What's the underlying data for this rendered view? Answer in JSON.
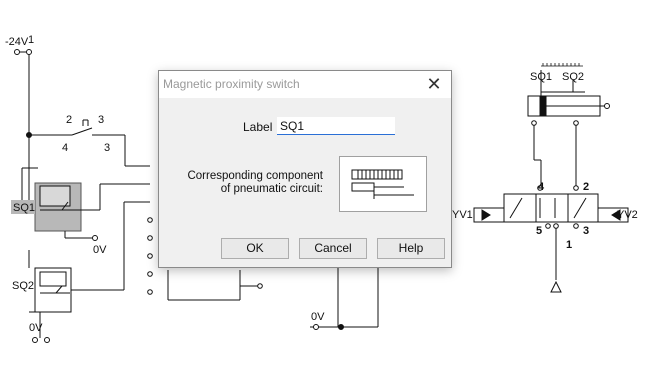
{
  "dialog": {
    "title": "Magnetic proximity switch",
    "close_glyph": "✕",
    "label_caption": "Label",
    "label_value": "SQ1",
    "component_caption": "Corresponding component of pneumatic circuit:",
    "buttons": {
      "ok": "OK",
      "cancel": "Cancel",
      "help": "Help"
    }
  },
  "electrical": {
    "supply_label": "-24V",
    "supply_node": "1",
    "switch_numbers": [
      "2",
      "3",
      "4",
      "3"
    ],
    "sensor_labels": [
      "SQ1",
      "SQ2"
    ],
    "ground_labels": [
      "0V",
      "0V",
      "0V"
    ]
  },
  "pneumatic": {
    "cylinder_sensor_labels": [
      "SQ1",
      "SQ2"
    ],
    "valve_left_label": "YV1",
    "valve_right_label": "YV2",
    "port_numbers": [
      "4",
      "2",
      "5",
      "3",
      "1"
    ]
  },
  "colors": {
    "selection": "#b8b8b8",
    "accent": "#2a6fd6",
    "line": "#111111"
  }
}
